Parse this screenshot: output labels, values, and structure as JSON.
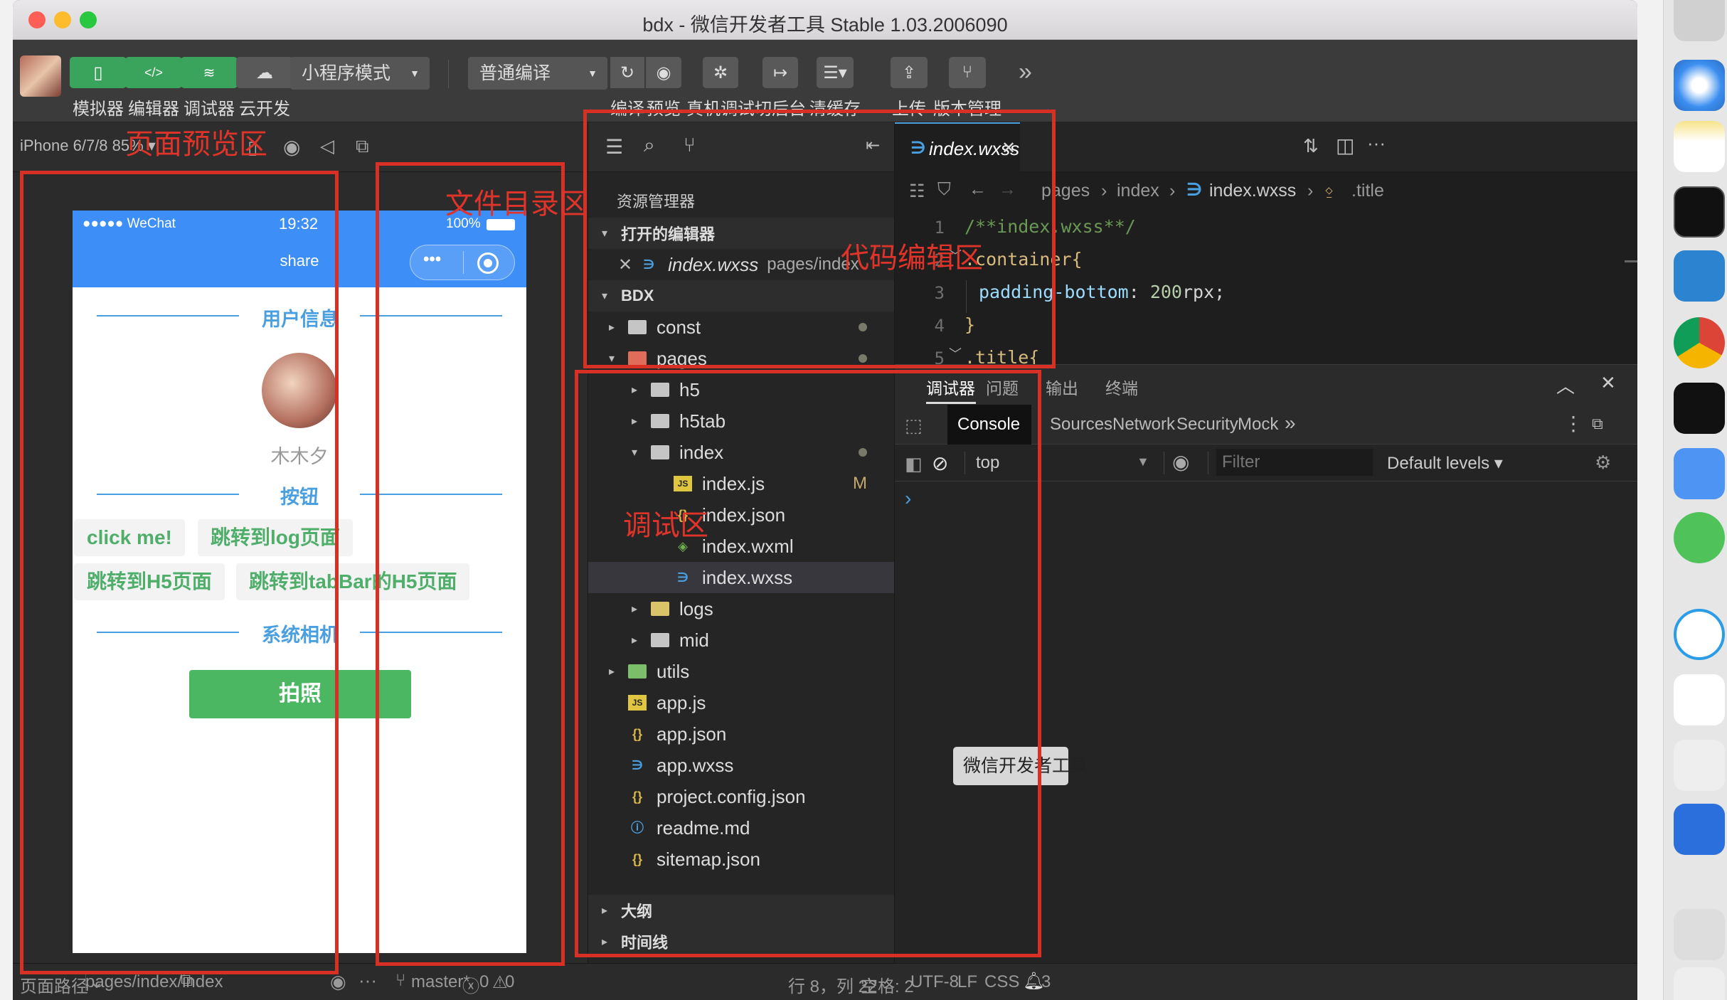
{
  "window": {
    "title": "bdx - 微信开发者工具 Stable 1.03.2006090"
  },
  "toolbar": {
    "buttons": [
      {
        "label": "模拟器",
        "icon": "phone-icon"
      },
      {
        "label": "编辑器",
        "icon": "code-icon"
      },
      {
        "label": "调试器",
        "icon": "debug-settings-icon"
      },
      {
        "label": "云开发",
        "icon": "cloud-icon"
      }
    ],
    "mode_select": "小程序模式",
    "compile_select": "普通编译",
    "right_buttons": [
      {
        "label": "编译",
        "icon": "refresh-icon"
      },
      {
        "label": "预览",
        "icon": "eye-icon"
      },
      {
        "label": "真机调试",
        "icon": "bug-icon"
      },
      {
        "label": "切后台",
        "icon": "switch-background-icon"
      },
      {
        "label": "清缓存",
        "icon": "layers-icon"
      },
      {
        "label": "上传",
        "icon": "upload-icon"
      },
      {
        "label": "版本管理",
        "icon": "branch-icon"
      }
    ],
    "more": "»"
  },
  "simulator": {
    "device": "iPhone 6/7/8 85% ▾",
    "statusbar": {
      "carrier": "●●●●● WeChat",
      "time": "19:32",
      "battery": "100%"
    },
    "nav_title": "share",
    "sections": {
      "user": "用户信息",
      "buttons": "按钮",
      "camera": "系统相机"
    },
    "username": "木木夕",
    "btn_click": "click me!",
    "btn_log": "跳转到log页面",
    "btn_h5": "跳转到H5页面",
    "btn_tabbar": "跳转到tabBar的H5页面",
    "btn_photo": "拍照"
  },
  "explorer": {
    "title": "资源管理器",
    "open_editors": "打开的编辑器",
    "open_file": "index.wxss",
    "open_file_path": "pages/index",
    "root": "BDX",
    "tree": [
      {
        "name": "const",
        "indent": 0,
        "type": "folder",
        "arrow": "▸",
        "mark": "dot"
      },
      {
        "name": "pages",
        "indent": 0,
        "type": "folder-red",
        "arrow": "▾",
        "mark": "dot"
      },
      {
        "name": "h5",
        "indent": 1,
        "type": "folder",
        "arrow": "▸",
        "mark": ""
      },
      {
        "name": "h5tab",
        "indent": 1,
        "type": "folder",
        "arrow": "▸",
        "mark": ""
      },
      {
        "name": "index",
        "indent": 1,
        "type": "folder",
        "arrow": "▾",
        "mark": "dot"
      },
      {
        "name": "index.js",
        "indent": 2,
        "type": "js",
        "arrow": "",
        "mark": "M"
      },
      {
        "name": "index.json",
        "indent": 2,
        "type": "json",
        "arrow": "",
        "mark": ""
      },
      {
        "name": "index.wxml",
        "indent": 2,
        "type": "wxml",
        "arrow": "",
        "mark": ""
      },
      {
        "name": "index.wxss",
        "indent": 2,
        "type": "wxss",
        "arrow": "",
        "mark": "",
        "selected": true
      },
      {
        "name": "logs",
        "indent": 1,
        "type": "folder-yellow",
        "arrow": "▸",
        "mark": ""
      },
      {
        "name": "mid",
        "indent": 1,
        "type": "folder",
        "arrow": "▸",
        "mark": ""
      },
      {
        "name": "utils",
        "indent": 0,
        "type": "folder-green",
        "arrow": "▸",
        "mark": ""
      },
      {
        "name": "app.js",
        "indent": 0,
        "type": "js",
        "arrow": "",
        "mark": ""
      },
      {
        "name": "app.json",
        "indent": 0,
        "type": "json",
        "arrow": "",
        "mark": ""
      },
      {
        "name": "app.wxss",
        "indent": 0,
        "type": "wxss",
        "arrow": "",
        "mark": ""
      },
      {
        "name": "project.config.json",
        "indent": 0,
        "type": "json",
        "arrow": "",
        "mark": ""
      },
      {
        "name": "readme.md",
        "indent": 0,
        "type": "info",
        "arrow": "",
        "mark": ""
      },
      {
        "name": "sitemap.json",
        "indent": 0,
        "type": "json",
        "arrow": "",
        "mark": ""
      }
    ],
    "outline": "大纲",
    "timeline": "时间线"
  },
  "editor": {
    "tab": "index.wxss",
    "breadcrumb": {
      "p1": "pages",
      "p2": "index",
      "p3": "index.wxss",
      "p4": ".title"
    },
    "lines": [
      {
        "n": "1",
        "text": "/**index.wxss**/"
      },
      {
        "n": "2",
        "text": ".container{"
      },
      {
        "n": "3",
        "prop": "padding-bottom",
        "val": "200",
        "unit": "rpx;"
      },
      {
        "n": "4",
        "text": "}"
      },
      {
        "n": "5",
        "text": ".title{"
      }
    ]
  },
  "debugger": {
    "tabs": [
      "调试器",
      "问题",
      "输出",
      "终端"
    ],
    "devtools_tabs": [
      "Console",
      "Sources",
      "Network",
      "Security",
      "Mock"
    ],
    "context": "top",
    "filter_placeholder": "Filter",
    "levels": "Default levels ▾",
    "prompt": "›"
  },
  "tooltip": "微信开发者工具",
  "statusbar": {
    "path_label": "页面路径",
    "path": "pages/index/index",
    "branch": "master*",
    "errors": "0",
    "warnings": "0",
    "position": "行 8，列 22",
    "spaces": "空格: 2",
    "encoding": "UTF-8",
    "eol": "LF",
    "lang": "CSS",
    "notifications": "3"
  },
  "annotations": {
    "preview": "页面预览区",
    "files": "文件目录区",
    "code": "代码编辑区",
    "debug": "调试区"
  }
}
